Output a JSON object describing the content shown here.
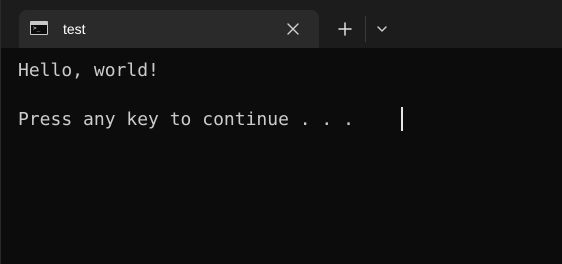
{
  "tab": {
    "icon": "terminal-icon",
    "title": "test",
    "close_icon": "close-icon"
  },
  "titlebar": {
    "new_tab_icon": "plus-icon",
    "dropdown_icon": "chevron-down-icon"
  },
  "terminal": {
    "lines": [
      "Hello, world!",
      "Press any key to continue . . ."
    ]
  },
  "colors": {
    "background": "#0c0c0c",
    "titlebar": "#1c1c1c",
    "active_tab": "#2a2a2a",
    "text": "#cccccc"
  }
}
